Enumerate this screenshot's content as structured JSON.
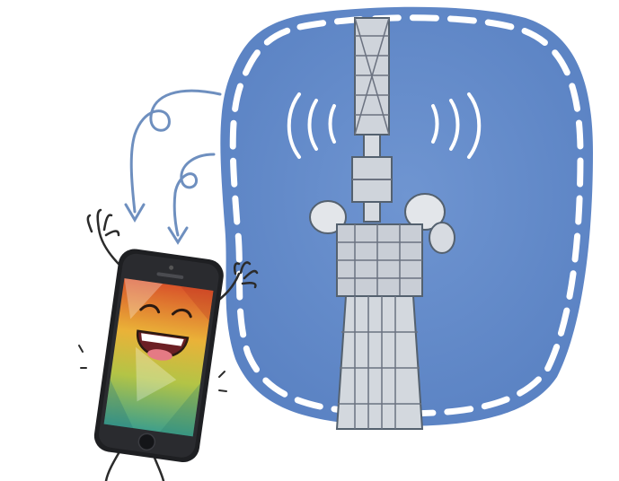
{
  "scene": {
    "subject": "cell-tower",
    "companion": "cartoon-smartphone",
    "icons": [
      "signal-waves-icon",
      "curved-arrow-icon",
      "smiling-face-icon"
    ]
  },
  "colors": {
    "sky": "#5a82c3",
    "sky_light": "#6f95d1",
    "dash": "#ffffff",
    "tower": "#c9ced6",
    "tower_dark": "#6b7280",
    "outline": "#54616f",
    "phone_body": "#1e1f22",
    "screen_top": "#e06a2b",
    "screen_mid": "#e8b536",
    "screen_bottom": "#4fae8c",
    "mouth": "#6b1f24"
  }
}
